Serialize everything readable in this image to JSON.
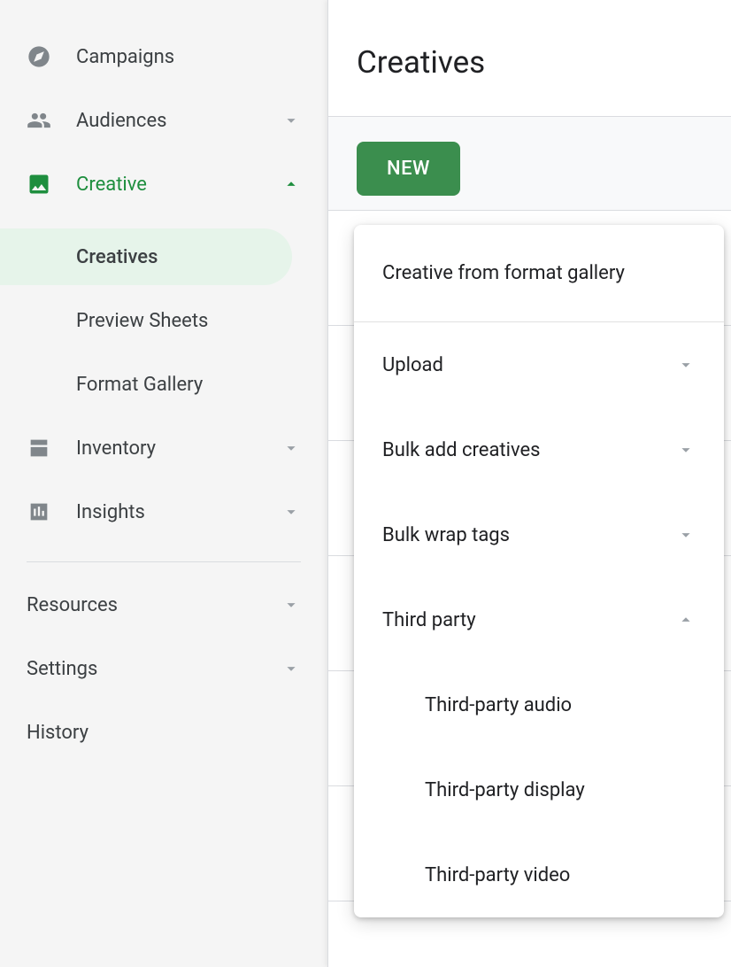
{
  "sidebar": {
    "campaigns": "Campaigns",
    "audiences": "Audiences",
    "creative": "Creative",
    "creative_sub": {
      "creatives": "Creatives",
      "preview_sheets": "Preview Sheets",
      "format_gallery": "Format Gallery"
    },
    "inventory": "Inventory",
    "insights": "Insights",
    "resources": "Resources",
    "settings": "Settings",
    "history": "History"
  },
  "page": {
    "title": "Creatives",
    "new_button": "NEW"
  },
  "menu": {
    "format_gallery": "Creative from format gallery",
    "upload": "Upload",
    "bulk_add": "Bulk add creatives",
    "bulk_wrap": "Bulk wrap tags",
    "third_party": "Third party",
    "third_party_sub": {
      "audio": "Third-party audio",
      "display": "Third-party display",
      "video": "Third-party video"
    }
  }
}
